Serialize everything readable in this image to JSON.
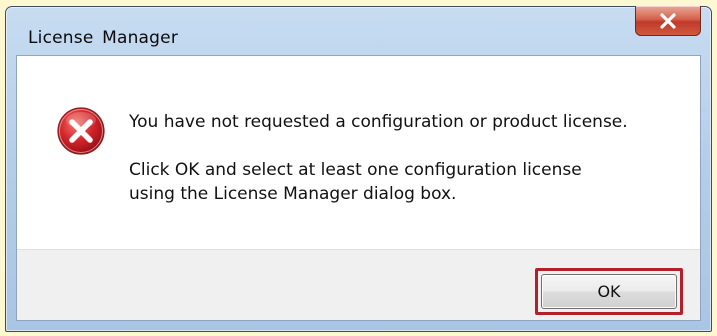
{
  "window": {
    "title": "License  Manager",
    "close_icon": "close-x-icon"
  },
  "message": {
    "icon": "error-icon",
    "line1": "You have not requested a configuration or product license.",
    "line2": "Click OK and select at least one configuration license",
    "line3": "using the License Manager dialog box."
  },
  "buttons": {
    "ok_label": "OK"
  },
  "colors": {
    "page_background": "#fdf7d2",
    "highlight_border": "#b3202a",
    "close_button": "#c7453a",
    "error_icon": "#c8202a"
  }
}
